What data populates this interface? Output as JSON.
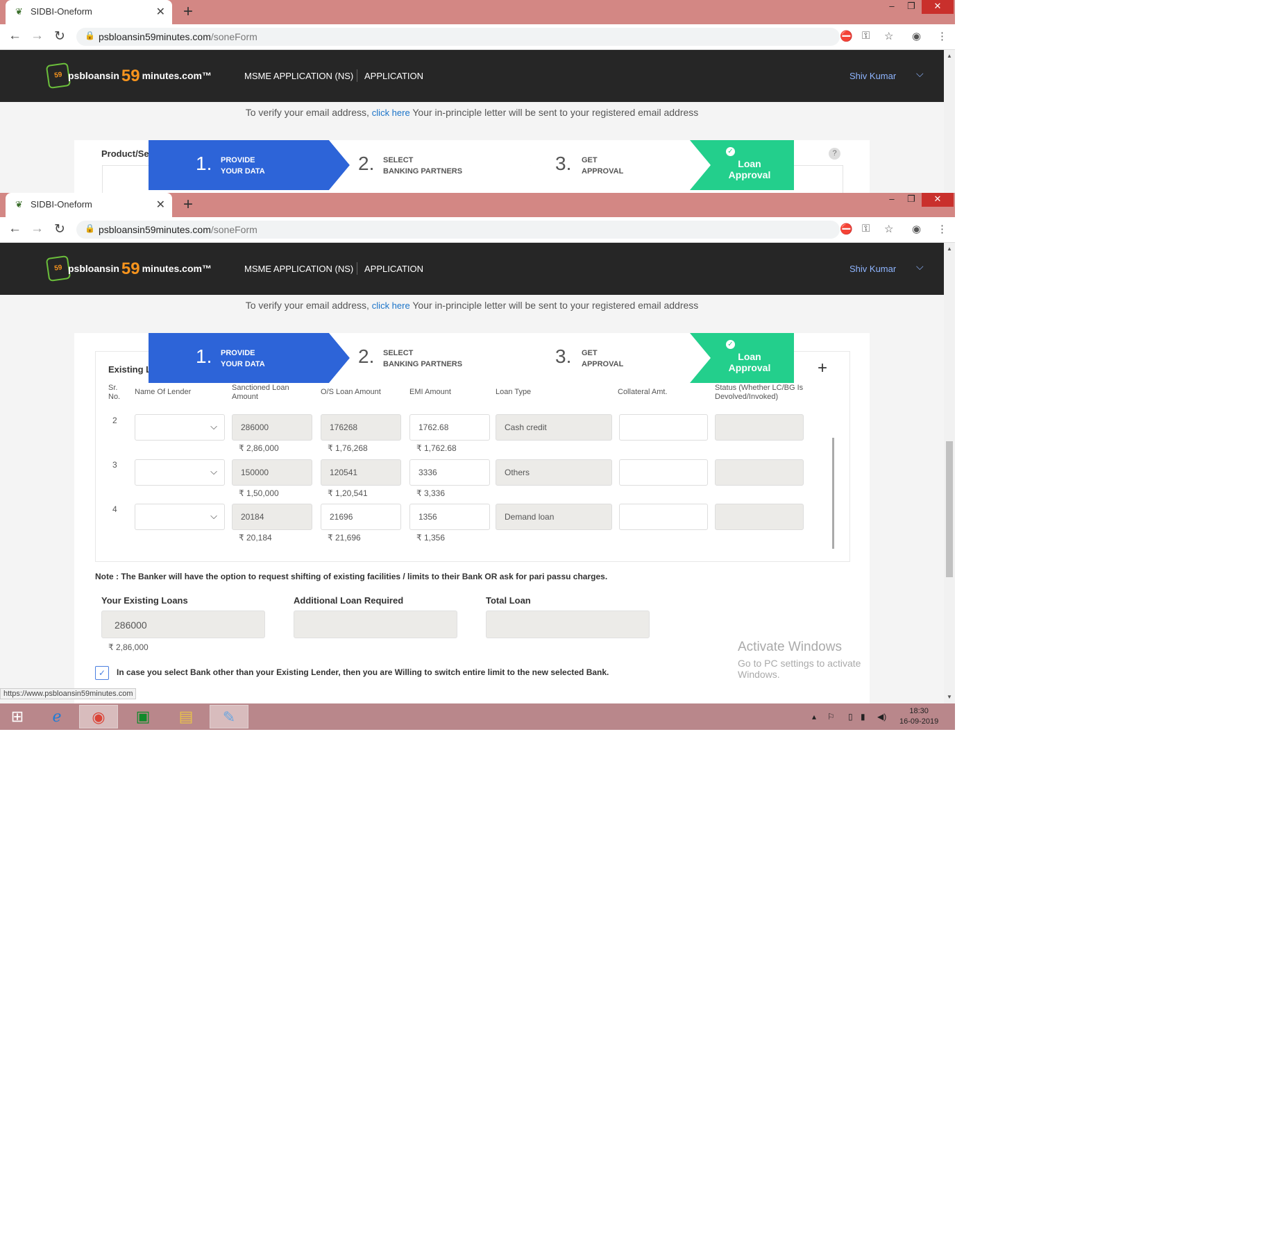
{
  "browser": {
    "tab_title": "SIDBI-Oneform",
    "url_host": "psbloansin59minutes.com",
    "url_path": "/soneForm",
    "new_tab": "+",
    "status_url": "https://www.psbloansin59minutes.com"
  },
  "header": {
    "logo_badge": "59",
    "logo_prefix": "psbloansin",
    "logo_num": "59",
    "logo_suffix": "minutes.com™",
    "nav_msme": "MSME APPLICATION (NS)",
    "nav_application": "APPLICATION",
    "user": "Shiv Kumar"
  },
  "verify": {
    "prefix": "To verify your email address,",
    "link": "click here",
    "suffix": "Your in-principle letter will be sent to your registered email address"
  },
  "steps": [
    {
      "num": "1.",
      "line1": "PROVIDE",
      "line2": "YOUR DATA"
    },
    {
      "num": "2.",
      "line1": "SELECT",
      "line2": "BANKING PARTNERS"
    },
    {
      "num": "3.",
      "line1": "GET",
      "line2": "APPROVAL"
    },
    {
      "line1": "Loan",
      "line2": "Approval"
    }
  ],
  "shot1": {
    "section_label": "Product/Se"
  },
  "loans": {
    "section_label": "Existing L",
    "add": "+",
    "columns": [
      "Sr. No.",
      "Name Of Lender",
      "Sanctioned Loan Amount",
      "O/S Loan Amount",
      "EMI Amount",
      "Loan Type",
      "Collateral Amt.",
      "Status (Whether LC/BG Is Devolved/Invoked)"
    ],
    "rows": [
      {
        "sr": "2",
        "sanctioned": "286000",
        "sanctioned_fmt": "₹ 2,86,000",
        "os": "176268",
        "os_fmt": "₹ 1,76,268",
        "emi": "1762.68",
        "emi_fmt": "₹ 1,762.68",
        "type": "Cash credit"
      },
      {
        "sr": "3",
        "sanctioned": "150000",
        "sanctioned_fmt": "₹ 1,50,000",
        "os": "120541",
        "os_fmt": "₹ 1,20,541",
        "emi": "3336",
        "emi_fmt": "₹ 3,336",
        "type": "Others"
      },
      {
        "sr": "4",
        "sanctioned": "20184",
        "sanctioned_fmt": "₹ 20,184",
        "os": "21696",
        "os_fmt": "₹ 21,696",
        "emi": "1356",
        "emi_fmt": "₹ 1,356",
        "type": "Demand loan"
      }
    ]
  },
  "note": "Note : The Banker will have the option to request shifting of existing facilities / limits to their Bank OR ask for pari passu charges.",
  "totals": {
    "existing_label": "Your Existing Loans",
    "existing_value": "286000",
    "existing_fmt": "₹ 2,86,000",
    "additional_label": "Additional Loan Required",
    "total_label": "Total Loan"
  },
  "switch_text": "In case you select Bank other than your Existing Lender, then you are Willing to switch entire limit to the new selected Bank.",
  "watermark": {
    "title": "Activate Windows",
    "subtitle": "Go to PC settings to activate Windows."
  },
  "clock": {
    "time": "18:30",
    "date": "16-09-2019"
  },
  "colors": {
    "primary": "#2d64d8",
    "success": "#23cf8c",
    "brand_orange": "#f7941d",
    "titlebar": "#d38784"
  }
}
